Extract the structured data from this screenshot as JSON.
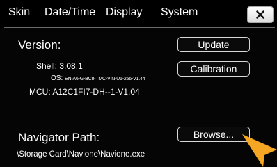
{
  "tabs": {
    "skin": "Skin",
    "datetime": "Date/Time",
    "display": "Display",
    "system": "System"
  },
  "close_icon": "close-icon",
  "version": {
    "label": "Version:",
    "shell_label": "Shell:",
    "shell_value": "3.08.1",
    "os_label": "OS:",
    "os_value": "EN-A6-G-BC8-TMC-VIN-U1-256-V1.44",
    "mcu_label": "MCU:",
    "mcu_value": "A12C1FI7-DH--1-V1.04"
  },
  "buttons": {
    "update": "Update",
    "calibration": "Calibration",
    "browse": "Browse..."
  },
  "navigator": {
    "label": "Navigator Path:",
    "path": "\\Storage Card\\Navione\\Navione.exe"
  },
  "pointer": {
    "icon": "arrow-pointer-icon",
    "color": "#f5a623"
  }
}
